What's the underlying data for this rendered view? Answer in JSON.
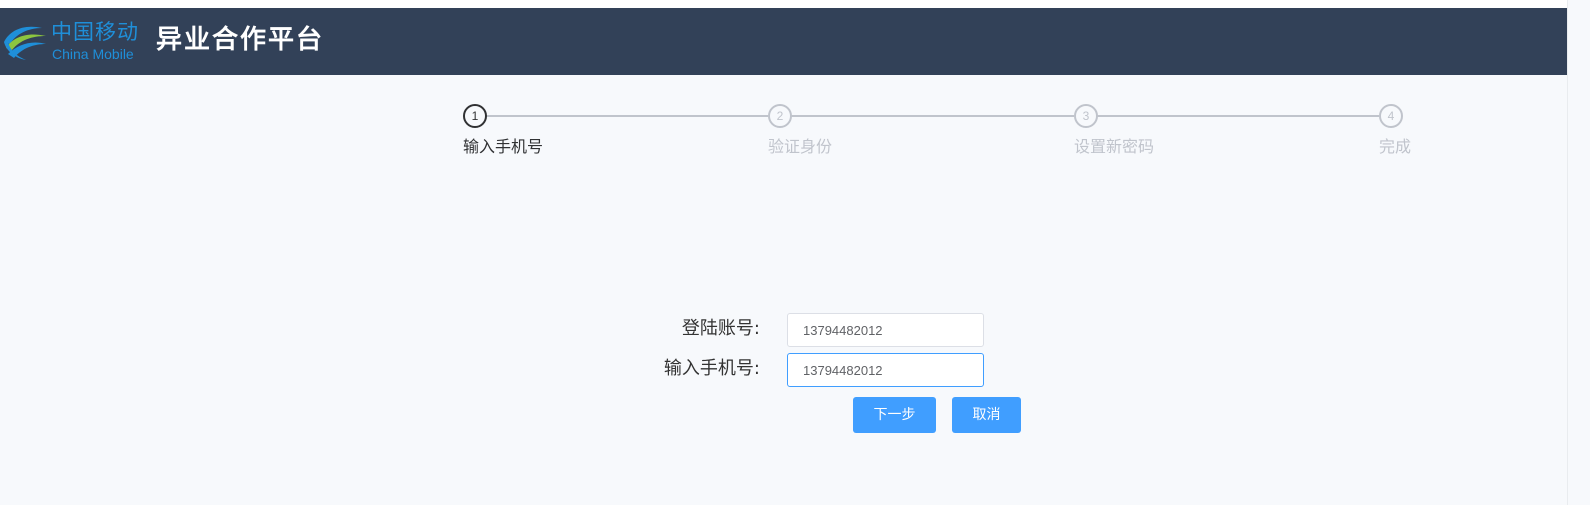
{
  "header": {
    "logo_cn": "中国移动",
    "logo_en": "China Mobile",
    "title": "异业合作平台",
    "background": "#324158",
    "logo_color": "#1f8fd9"
  },
  "steps": [
    {
      "number": "1",
      "label": "输入手机号",
      "state": "active"
    },
    {
      "number": "2",
      "label": "验证身份",
      "state": "pending"
    },
    {
      "number": "3",
      "label": "设置新密码",
      "state": "pending"
    },
    {
      "number": "4",
      "label": "完成",
      "state": "pending"
    }
  ],
  "form": {
    "account_label": "登陆账号:",
    "account_value": "13794482012",
    "phone_label": "输入手机号:",
    "phone_value": "13794482012"
  },
  "buttons": {
    "next_label": "下一步",
    "cancel_label": "取消"
  },
  "colors": {
    "primary": "#409eff",
    "page_bg": "#f7f9fc",
    "step_active": "#303133",
    "step_inactive": "#c0c4cc"
  }
}
